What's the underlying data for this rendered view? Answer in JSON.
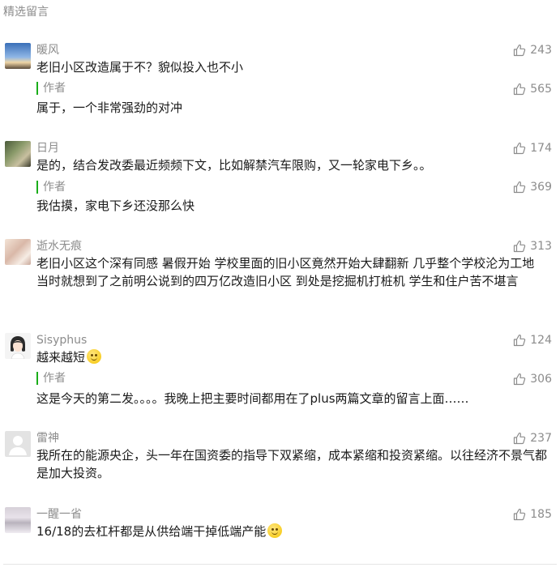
{
  "section_title": "精选留言",
  "author_label": "作者",
  "comments": [
    {
      "nick": "暖风",
      "likes": "243",
      "text": "老旧小区改造属于不？貌似投入也不小",
      "reply_likes": "565",
      "reply": "属于，一个非常强劲的对冲"
    },
    {
      "nick": "日月",
      "likes": "174",
      "text": "是的，结合发改委最近频频下文，比如解禁汽车限购，又一轮家电下乡。。",
      "reply_likes": "369",
      "reply": "我估摸，家电下乡还没那么快"
    },
    {
      "nick": "逝水无痕",
      "likes": "313",
      "text": "老旧小区这个深有同感 暑假开始 学校里面的旧小区竟然开始大肆翻新 几乎整个学校沦为工地 当时就想到了之前明公说到的四万亿改造旧小区 到处是挖掘机打桩机 学生和住户苦不堪言"
    },
    {
      "nick": "Sisyphus",
      "likes": "124",
      "text": "越来越短",
      "reply_likes": "306",
      "reply": "这是今天的第二发。。。。我晚上把主要时间都用在了plus两篇文章的留言上面……"
    },
    {
      "nick": "雷神",
      "likes": "237",
      "text": "我所在的能源央企，头一年在国资委的指导下双紧缩，成本紧缩和投资紧缩。以往经济不景气都是加大投资。"
    },
    {
      "nick": "一醒一省",
      "likes": "185",
      "text": "16/18的去杠杆都是从供给端干掉低端产能"
    }
  ]
}
